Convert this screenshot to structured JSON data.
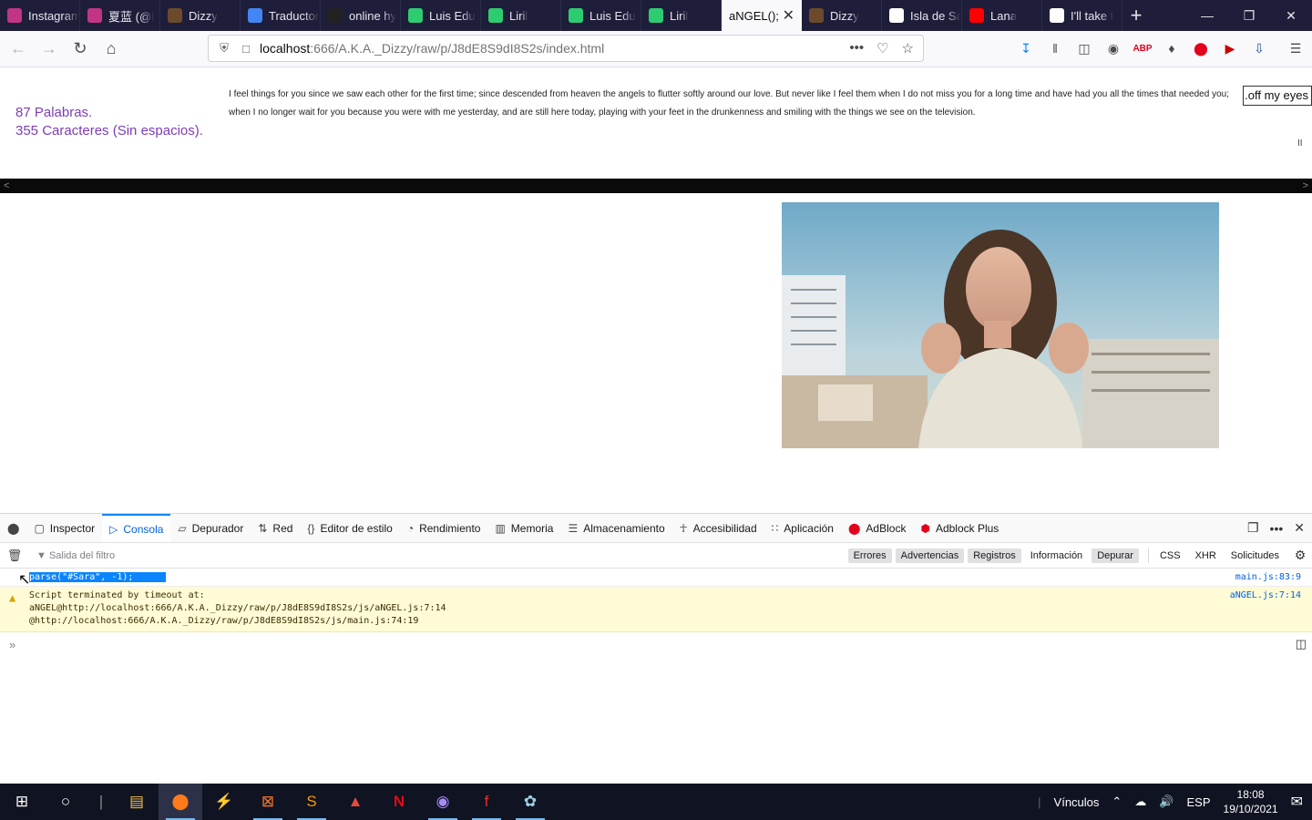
{
  "browser": {
    "tabs": [
      {
        "label": "Instagram",
        "icon": "instagram-icon",
        "color": "#c13584"
      },
      {
        "label": "夏蓝 (@l",
        "icon": "instagram-icon",
        "color": "#c13584"
      },
      {
        "label": "Dizzy",
        "icon": "page-icon",
        "color": "#6b4a2b"
      },
      {
        "label": "Traductor",
        "icon": "translate-icon",
        "color": "#4285f4"
      },
      {
        "label": "online hy",
        "icon": "page-icon",
        "color": "#222222"
      },
      {
        "label": "Luis Edu",
        "icon": "chart-icon",
        "color": "#2ecc71"
      },
      {
        "label": "Liril",
        "icon": "chart-icon",
        "color": "#2ecc71"
      },
      {
        "label": "Luis Edu",
        "icon": "chart-icon",
        "color": "#2ecc71"
      },
      {
        "label": "Liril",
        "icon": "chart-icon",
        "color": "#2ecc71"
      },
      {
        "label": "aNGEL();",
        "icon": "page-icon",
        "color": "#ffffff",
        "active": true
      },
      {
        "label": "Dizzy",
        "icon": "page-icon",
        "color": "#6b4a2b"
      },
      {
        "label": "Isla de Sa",
        "icon": "wikipedia-icon",
        "color": "#ffffff"
      },
      {
        "label": "Lana",
        "icon": "youtube-icon",
        "color": "#ff0000"
      },
      {
        "label": "I'll take t",
        "icon": "google-icon",
        "color": "#ffffff"
      }
    ],
    "url_host": "localhost",
    "url_rest": ":666/A.K.A._Dizzy/raw/p/J8dE8S9dI8S2s/index.html"
  },
  "page": {
    "word_count": "87 Palabras.",
    "char_count": "355 Caracteres (Sin espacios).",
    "poem": "I feel things for you since we saw each other for the first time; since descended from heaven the angels to flutter softly around our love. But never like I feel them when I do not miss you for a long time and have had you all the times that needed you; when I no longer wait for you because you were with me yesterday, and are still here today, playing with your feet in the drunkenness and smiling with the things we see on the television.",
    "input_tail": "off my eyes.",
    "pause_symbol": "II",
    "scroll_left": "<",
    "scroll_right": ">"
  },
  "devtools": {
    "tabs": [
      {
        "label": "Inspector",
        "icon": "inspector-icon"
      },
      {
        "label": "Consola",
        "icon": "console-icon",
        "active": true
      },
      {
        "label": "Depurador",
        "icon": "debugger-icon"
      },
      {
        "label": "Red",
        "icon": "network-icon"
      },
      {
        "label": "Editor de estilo",
        "icon": "style-editor-icon"
      },
      {
        "label": "Rendimiento",
        "icon": "performance-icon"
      },
      {
        "label": "Memoria",
        "icon": "memory-icon"
      },
      {
        "label": "Almacenamiento",
        "icon": "storage-icon"
      },
      {
        "label": "Accesibilidad",
        "icon": "accessibility-icon"
      },
      {
        "label": "Aplicación",
        "icon": "application-icon"
      },
      {
        "label": "AdBlock",
        "icon": "adblock-icon"
      },
      {
        "label": "Adblock Plus",
        "icon": "adblock-plus-icon"
      }
    ],
    "filter_placeholder": "Salida del filtro",
    "filters": [
      {
        "label": "Errores",
        "on": true
      },
      {
        "label": "Advertencias",
        "on": true
      },
      {
        "label": "Registros",
        "on": true
      },
      {
        "label": "Información",
        "on": false
      },
      {
        "label": "Depurar",
        "on": true
      }
    ],
    "extra_filters": [
      "CSS",
      "XHR",
      "Solicitudes"
    ],
    "console": {
      "input_echo": "parse(\"#Sara\", -1);",
      "input_src": "main.js:83:9",
      "warning_lines": [
        "Script terminated by timeout at:",
        "aNGEL@http://localhost:666/A.K.A._Dizzy/raw/p/J8dE8S9dI8S2s/js/aNGEL.js:7:14",
        "@http://localhost:666/A.K.A._Dizzy/raw/p/J8dE8S9dI8S2s/js/main.js:74:19"
      ],
      "warning_src": "aNGEL.js:7:14",
      "prompt": "»"
    }
  },
  "taskbar": {
    "tray_label": "Vínculos",
    "lang": "ESP",
    "time": "18:08",
    "date": "19/10/2021"
  }
}
